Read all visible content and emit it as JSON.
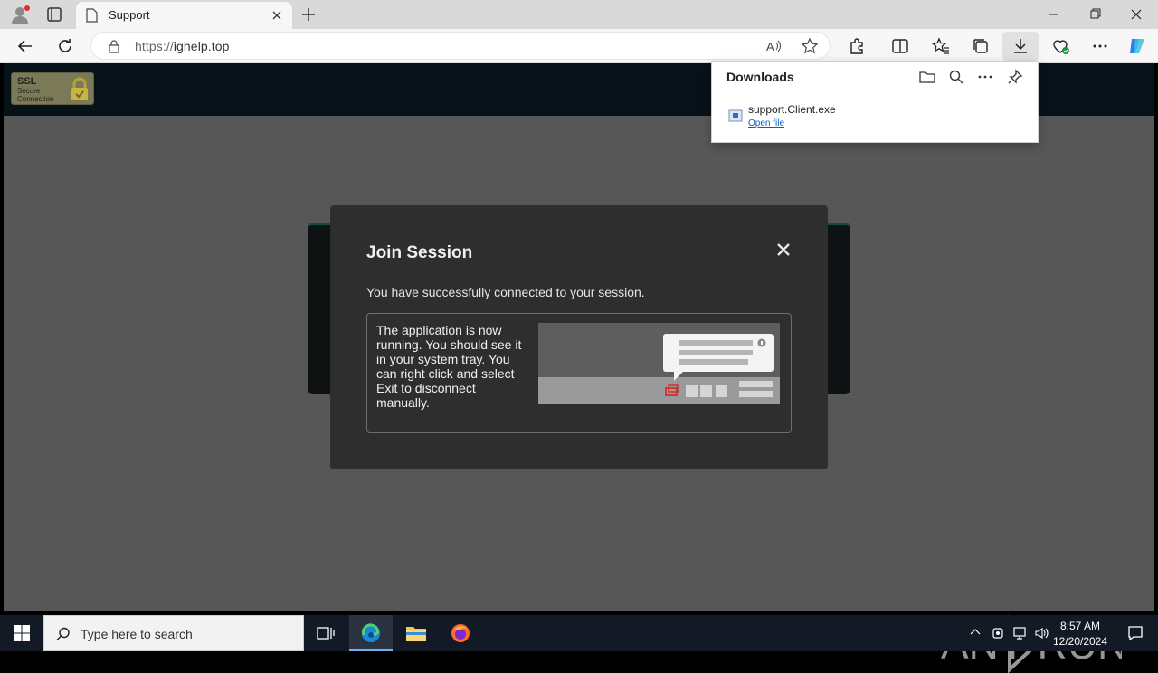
{
  "browser": {
    "tab_title": "Support",
    "url": "https://ighelp.top",
    "url_scheme": "https://",
    "url_host": "ighelp.top"
  },
  "page": {
    "ssl_badge": {
      "line1": "SSL",
      "line2": "Secure",
      "line3": "Connection"
    }
  },
  "modal": {
    "title": "Join Session",
    "message": "You have successfully connected to your session.",
    "info": "The application is now running. You should see it in your system tray. You can right click and select Exit to disconnect manually."
  },
  "downloads": {
    "title": "Downloads",
    "filename": "support.Client.exe",
    "open_label": "Open file"
  },
  "taskbar": {
    "search_placeholder": "Type here to search",
    "time": "8:57 AM",
    "date": "12/20/2024"
  },
  "watermark": {
    "text": "ANY RUN"
  },
  "colors": {
    "page_bg": "#575757",
    "modal_bg": "#2e2e2e",
    "header_bg": "#071118",
    "taskbar_bg": "#141a25",
    "link": "#0a5ec2",
    "accent_edge": "#6fb1ee"
  }
}
